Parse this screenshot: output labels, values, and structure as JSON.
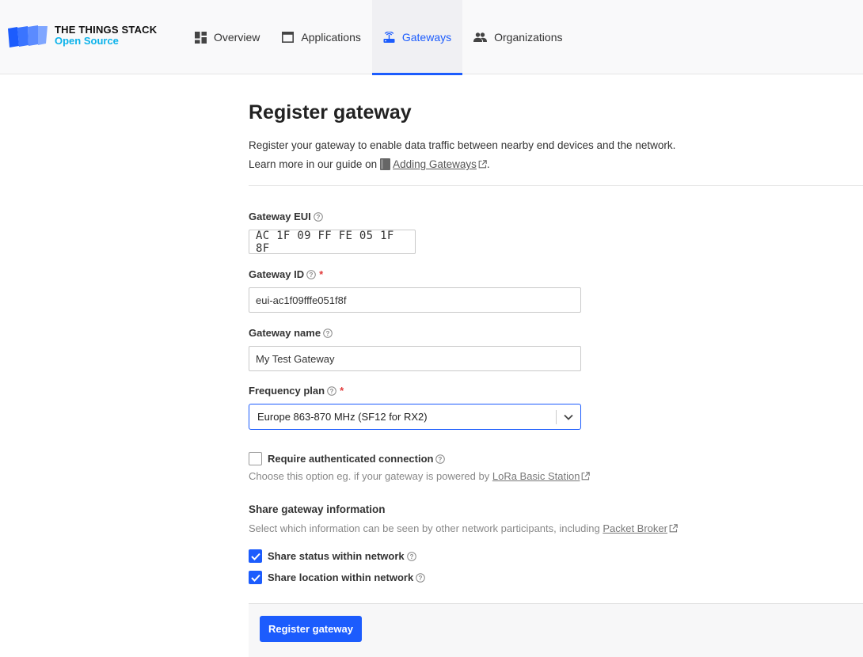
{
  "brand": {
    "title": "THE THINGS STACK",
    "subtitle": "Open Source",
    "accent": "#1c5cfd",
    "subtitle_color": "#0bb2ea"
  },
  "nav": {
    "items": [
      {
        "label": "Overview",
        "icon": "dashboard-icon",
        "active": false
      },
      {
        "label": "Applications",
        "icon": "window-icon",
        "active": false
      },
      {
        "label": "Gateways",
        "icon": "router-icon",
        "active": true
      },
      {
        "label": "Organizations",
        "icon": "people-icon",
        "active": false
      }
    ]
  },
  "page": {
    "title": "Register gateway",
    "description": "Register your gateway to enable data traffic between nearby end devices and the network.",
    "guide_prefix": "Learn more in our guide on",
    "guide_link": "Adding Gateways",
    "guide_suffix": "."
  },
  "form": {
    "gateway_eui": {
      "label": "Gateway EUI",
      "value": "AC 1F 09 FF FE 05 1F 8F"
    },
    "gateway_id": {
      "label": "Gateway ID",
      "value": "eui-ac1f09fffe051f8f",
      "required_mark": "*"
    },
    "gateway_name": {
      "label": "Gateway name",
      "value": "My Test Gateway"
    },
    "frequency_plan": {
      "label": "Frequency plan",
      "value": "Europe 863-870 MHz (SF12 for RX2)",
      "required_mark": "*"
    },
    "require_auth": {
      "label": "Require authenticated connection",
      "checked": false,
      "hint_prefix": "Choose this option eg. if your gateway is powered by",
      "hint_link": "LoRa Basic Station"
    },
    "share": {
      "title": "Share gateway information",
      "hint_prefix": "Select which information can be seen by other network participants, including",
      "hint_link": "Packet Broker",
      "status_label": "Share status within network",
      "status_checked": true,
      "location_label": "Share location within network",
      "location_checked": true
    },
    "submit_label": "Register gateway"
  }
}
